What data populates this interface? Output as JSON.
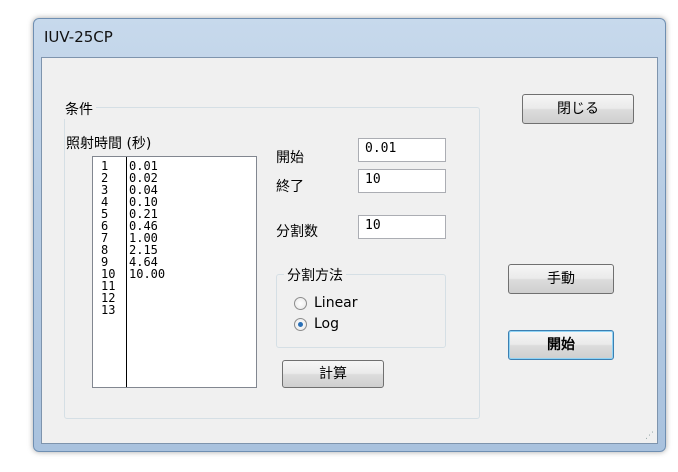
{
  "window": {
    "title": "IUV-25CP"
  },
  "conditions": {
    "group_label": "条件",
    "irradiation_label": "照射時間 (秒)",
    "list": [
      {
        "index": "1",
        "value": "0.01"
      },
      {
        "index": "2",
        "value": "0.02"
      },
      {
        "index": "3",
        "value": "0.04"
      },
      {
        "index": "4",
        "value": "0.10"
      },
      {
        "index": "5",
        "value": "0.21"
      },
      {
        "index": "6",
        "value": "0.46"
      },
      {
        "index": "7",
        "value": "1.00"
      },
      {
        "index": "8",
        "value": "2.15"
      },
      {
        "index": "9",
        "value": "4.64"
      },
      {
        "index": "10",
        "value": "10.00"
      },
      {
        "index": "11",
        "value": ""
      },
      {
        "index": "12",
        "value": ""
      },
      {
        "index": "13",
        "value": ""
      }
    ],
    "start_label": "開始",
    "start_value": "0.01",
    "end_label": "終了",
    "end_value": "10",
    "divisions_label": "分割数",
    "divisions_value": "10",
    "method_group_label": "分割方法",
    "method_linear_label": "Linear",
    "method_log_label": "Log",
    "selected_method": "Log",
    "calc_button": "計算"
  },
  "buttons": {
    "close": "閉じる",
    "manual": "手動",
    "start": "開始"
  }
}
